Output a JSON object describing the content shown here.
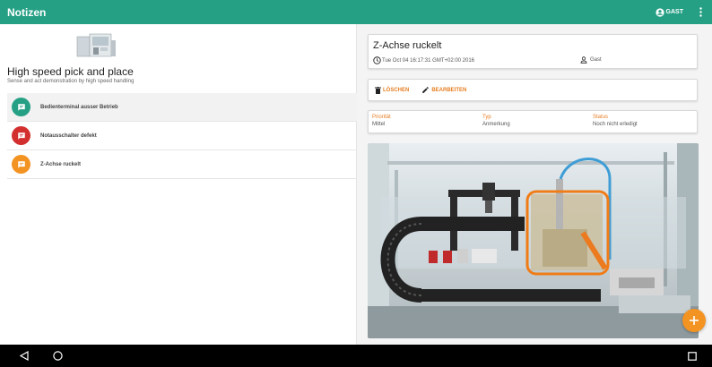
{
  "appbar": {
    "title": "Notizen",
    "user_label": "GAST"
  },
  "project": {
    "title": "High speed pick and place",
    "subtitle": "Sense and act demonstration by high speed handling"
  },
  "notes": [
    {
      "label": "Bedienterminal ausser Betrieb",
      "color": "#26a085"
    },
    {
      "label": "Notausschalter defekt",
      "color": "#d32f2f"
    },
    {
      "label": "Z-Achse ruckelt",
      "color": "#f39322"
    }
  ],
  "detail": {
    "title": "Z-Achse ruckelt",
    "datetime": "Tue Oct 04 16:17:31 GMT+02:00 2016",
    "author": "Gast",
    "actions": {
      "delete": "LÖSCHEN",
      "edit": "BEARBEITEN"
    },
    "fields": [
      {
        "key": "Priorität",
        "value": "Mittel"
      },
      {
        "key": "Typ",
        "value": "Anmerkung"
      },
      {
        "key": "Status",
        "value": "Noch nicht erledigt"
      }
    ]
  },
  "colors": {
    "primary": "#26a085",
    "accent": "#f39322",
    "action": "#e67e22"
  },
  "icons": {
    "user": "account-circle-icon",
    "more": "more-vert-icon",
    "note": "message-icon",
    "clock": "clock-icon",
    "person": "person-icon",
    "delete": "trash-icon",
    "edit": "pencil-icon",
    "add": "plus-icon"
  }
}
